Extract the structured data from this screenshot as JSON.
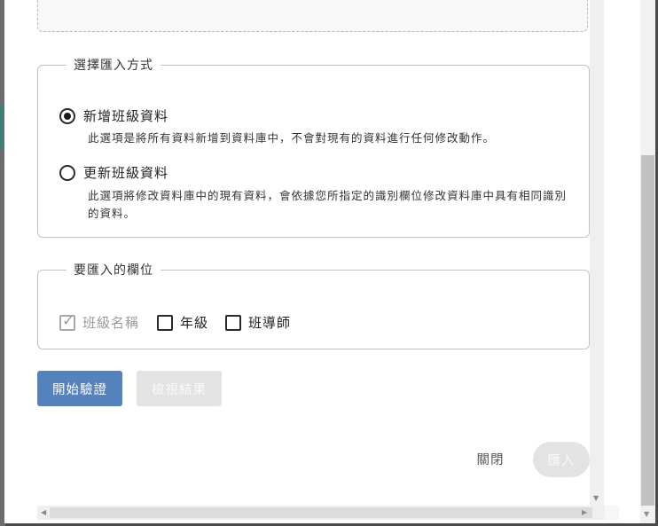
{
  "import_mode": {
    "legend": "選擇匯入方式",
    "options": [
      {
        "label": "新增班級資料",
        "description": "此選項是將所有資料新增到資料庫中，不會對現有的資料進行任何修改動作。",
        "checked": true
      },
      {
        "label": "更新班級資料",
        "description": "此選項將修改資料庫中的現有資料，會依據您所指定的識別欄位修改資料庫中具有相同識別的資料。",
        "checked": false
      }
    ]
  },
  "fields": {
    "legend": "要匯入的欄位",
    "items": [
      {
        "label": "班級名稱",
        "checked": true,
        "disabled": true
      },
      {
        "label": "年級",
        "checked": false,
        "disabled": false
      },
      {
        "label": "班導師",
        "checked": false,
        "disabled": false
      }
    ]
  },
  "actions": {
    "validate_label": "開始驗證",
    "view_results_label": "檢視結果",
    "close_label": "關閉",
    "import_label": "匯入"
  },
  "icons": {
    "scroll_left": "scroll-left-arrow-icon",
    "scroll_right": "scroll-right-arrow-icon",
    "scroll_down": "scroll-down-arrow-icon"
  },
  "colors": {
    "primary": "#5581bd",
    "disabled": "#e3e3e3",
    "border": "#c3c3c3"
  }
}
